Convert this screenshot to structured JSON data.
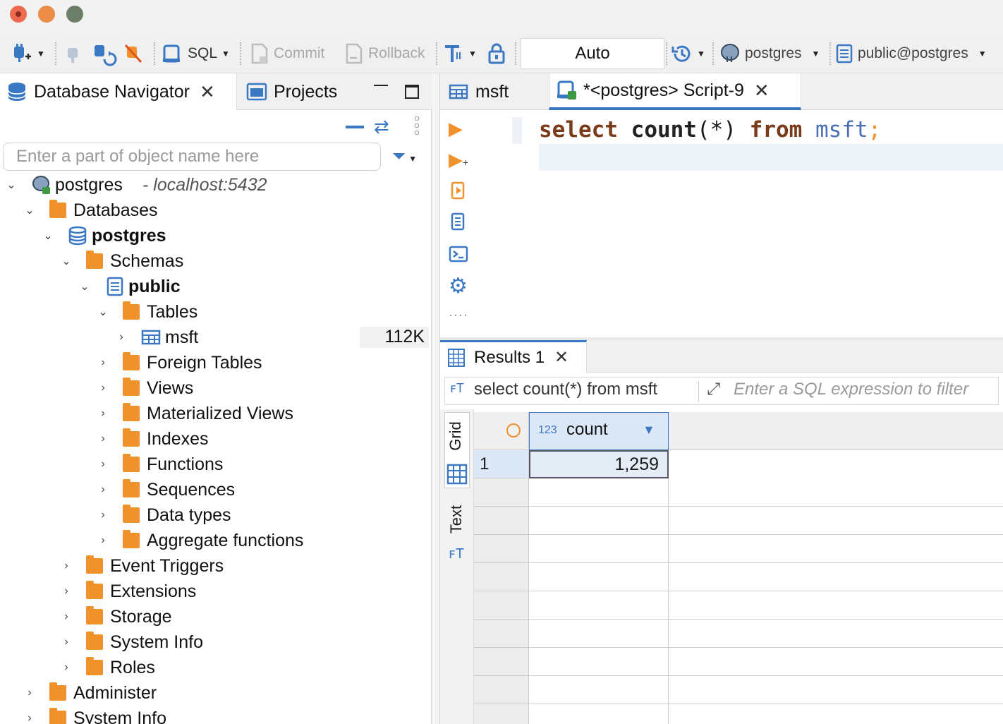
{
  "window": {
    "traffic_lights": [
      "close",
      "minimize",
      "zoom"
    ]
  },
  "toolbar": {
    "sql_label": "SQL",
    "commit_label": "Commit",
    "rollback_label": "Rollback",
    "transaction_mode": "Auto",
    "datasource": "postgres",
    "schema": "public@postgres"
  },
  "left_panel": {
    "tabs": [
      {
        "label": "Database Navigator"
      },
      {
        "label": "Projects"
      }
    ],
    "search_placeholder": "Enter a part of object name here",
    "tree": {
      "connection_name": "postgres",
      "connection_host": "- localhost:5432",
      "databases_label": "Databases",
      "database_name": "postgres",
      "schemas_label": "Schemas",
      "schema_name": "public",
      "tables_label": "Tables",
      "table_name": "msft",
      "table_size": "112K",
      "schema_children": [
        "Foreign Tables",
        "Views",
        "Materialized Views",
        "Indexes",
        "Functions",
        "Sequences",
        "Data types",
        "Aggregate functions"
      ],
      "database_children": [
        "Event Triggers",
        "Extensions",
        "Storage",
        "System Info",
        "Roles"
      ],
      "connection_children": [
        "Administer",
        "System Info"
      ]
    }
  },
  "editor": {
    "tabs": [
      {
        "label": "msft"
      },
      {
        "label": "*<postgres> Script-9"
      }
    ],
    "code": {
      "kw_select": "select",
      "fn_count": "count",
      "paren_open": "(",
      "star": "*",
      "paren_close": ")",
      "kw_from": "from",
      "ident": "msft",
      "semi": ";"
    }
  },
  "results": {
    "tab_label": "Results 1",
    "query_text": "select count(*) from msft",
    "filter_placeholder": "Enter a SQL expression to filter",
    "side_tabs": [
      "Grid",
      "Text"
    ],
    "column": {
      "type_prefix": "123",
      "name": "count"
    },
    "rows": [
      {
        "row_number": "1",
        "count": "1,259"
      }
    ]
  },
  "colors": {
    "folder_orange": "#f0922b",
    "accent_blue": "#3b78c4",
    "keyword_brown": "#7a3b1a",
    "identifier_blue": "#4a6fb5",
    "semicolon_orange": "#f0922b"
  }
}
